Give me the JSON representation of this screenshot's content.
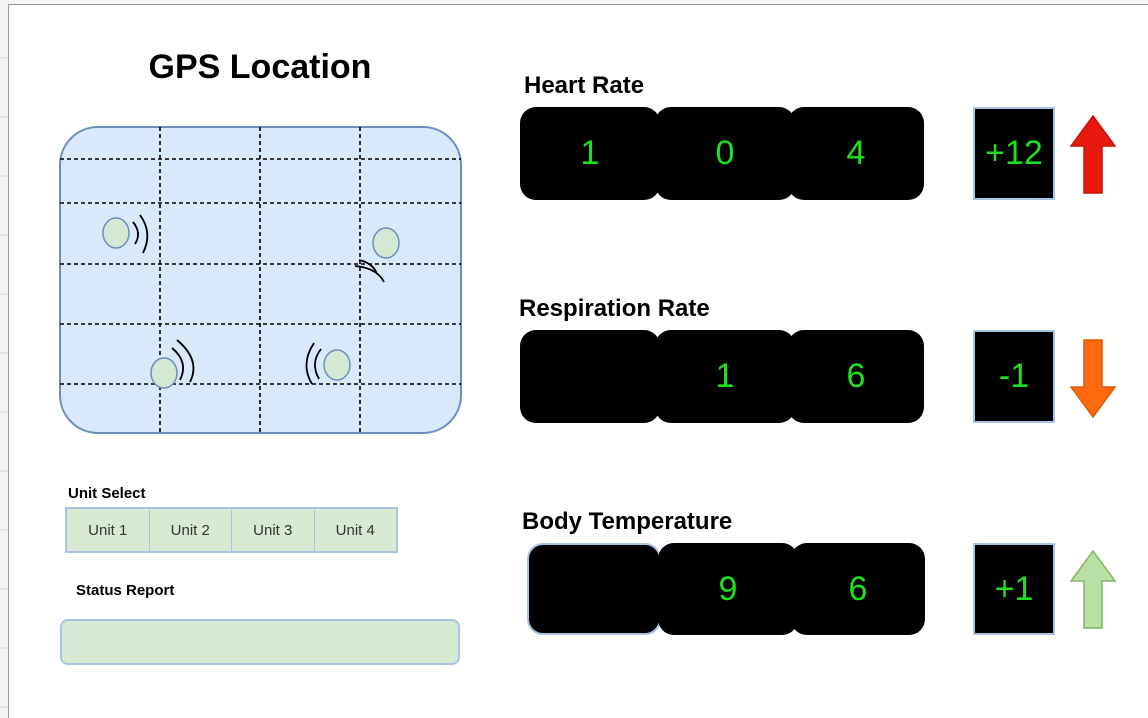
{
  "gps": {
    "title": "GPS Location"
  },
  "unit_select": {
    "label": "Unit Select",
    "units": [
      "Unit 1",
      "Unit 2",
      "Unit 3",
      "Unit 4"
    ]
  },
  "status_report": {
    "label": "Status Report",
    "value": ""
  },
  "vitals": {
    "heart_rate": {
      "title": "Heart Rate",
      "digits": [
        "1",
        "0",
        "4"
      ],
      "delta": "+12",
      "trend": "up",
      "trend_color": "#e8190c"
    },
    "respiration_rate": {
      "title": "Respiration Rate",
      "digits": [
        "",
        "1",
        "6"
      ],
      "delta": "-1",
      "trend": "down",
      "trend_color": "#ff6a10"
    },
    "body_temperature": {
      "title": "Body Temperature",
      "digits": [
        "",
        "9",
        "6"
      ],
      "delta": "+1",
      "trend": "up",
      "trend_color": "#b9e0a5"
    }
  },
  "colors": {
    "digit_text": "#1ee01e",
    "display_bg": "#000000",
    "map_fill": "#dae8fc",
    "map_border": "#6c8ebf",
    "panel_fill": "#d8ead3",
    "panel_border": "#a9c3e3",
    "marker_fill": "#d5e8d4"
  },
  "icons": {
    "map_marker": "signal-marker-icon",
    "trend_up": "arrow-up-icon",
    "trend_down": "arrow-down-icon"
  }
}
